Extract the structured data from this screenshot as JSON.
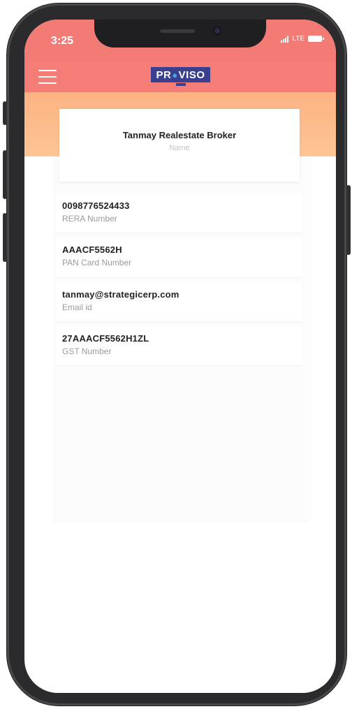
{
  "status_bar": {
    "time": "3:25",
    "network": "LTE"
  },
  "app_bar": {
    "menu_icon": "hamburger-menu-icon",
    "logo": {
      "prefix": "PR",
      "suffix": "VISO",
      "icon": "water-drop-icon"
    },
    "color": "#f57d77"
  },
  "profile": {
    "name": "Tanmay Realestate Broker",
    "name_caption": "Name"
  },
  "details": [
    {
      "value": "0098776524433",
      "label": "RERA Number"
    },
    {
      "value": "AAACF5562H",
      "label": "PAN Card Number"
    },
    {
      "value": "tanmay@strategicerp.com",
      "label": "Email id"
    },
    {
      "value": "27AAACF5562H1ZL",
      "label": "GST Number"
    }
  ],
  "colors": {
    "status_bar": "#f27b76",
    "header_band": "#fdb283",
    "logo_bg": "#3b3f8f"
  }
}
